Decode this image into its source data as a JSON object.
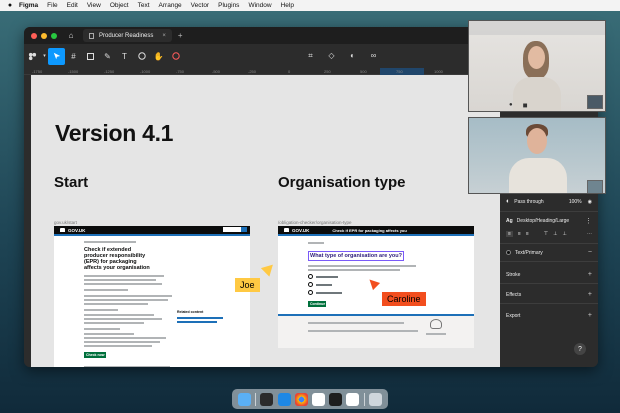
{
  "menubar": {
    "apple": "",
    "app": "Figma",
    "items": [
      "File",
      "Edit",
      "View",
      "Object",
      "Text",
      "Arrange",
      "Vector",
      "Plugins",
      "Window",
      "Help"
    ]
  },
  "window": {
    "home_icon": "⌂",
    "tab_title": "Producer Readiness",
    "tab_close": "×",
    "new_tab": "+"
  },
  "ruler": {
    "ticks": [
      "-1750",
      "-1500",
      "-1250",
      "-1000",
      "-750",
      "-500",
      "-250",
      "0",
      "250",
      "500",
      "750",
      "1000"
    ]
  },
  "canvas": {
    "version_title": "Version 4.1",
    "col1_title": "Start",
    "col2_title": "Organisation type",
    "frame1_label": "gov.uk/start",
    "frame2_label": "/obligation-checker/organisation-type",
    "frame1": {
      "brand": "GOV.UK",
      "heading": "Check if extended producer responsibility (EPR) for packaging affects your organisation",
      "button": "Check now",
      "related": "Related content"
    },
    "frame2": {
      "brand": "GOV.UK",
      "service_name": "Check if EPR for packaging affects you",
      "question": "What type of organisation are you?",
      "options_count_text": "",
      "button": "Continue"
    },
    "cursors": [
      {
        "name": "Joe",
        "color": "#ffc943"
      },
      {
        "name": "Caroline",
        "color": "#f24e1e"
      }
    ]
  },
  "panel": {
    "layer_mode": "Pass through",
    "opacity": "100%",
    "text_style_label": "Ag",
    "text_style": "Desktop/Heading/Large",
    "fill_style": "Text/Primary",
    "sections": [
      "Stroke",
      "Effects",
      "Export"
    ],
    "help": "?"
  },
  "colors": {
    "accent": "#0d99ff",
    "gov_black": "#0b0c0c",
    "gov_blue": "#1d70b8",
    "gov_green": "#00703c"
  },
  "dock": {
    "apps": [
      "finder-icon",
      "terminal-icon",
      "vscode-icon",
      "chrome-icon",
      "slack-icon",
      "figma-icon",
      "calendar-icon",
      "trash-icon"
    ]
  }
}
